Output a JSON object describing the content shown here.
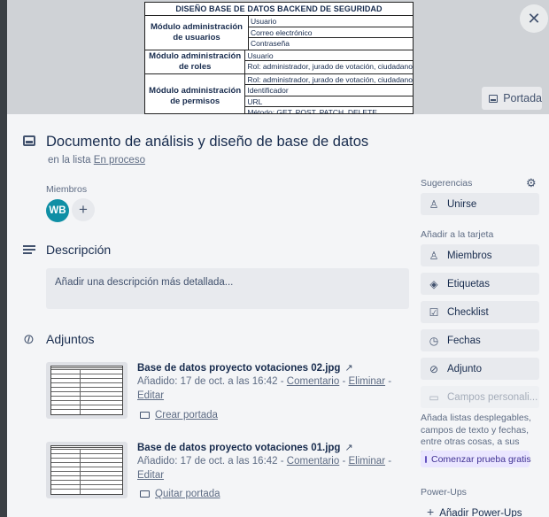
{
  "cover": {
    "table_title": "DISEÑO BASE DE DATOS BACKEND DE SEGURIDAD",
    "rows": [
      {
        "module": "Módulo administración de usuarios",
        "fields": [
          "Usuario",
          "Correo electrónico",
          "Contraseña"
        ]
      },
      {
        "module": "Módulo administración de roles",
        "fields": [
          "Usuario",
          "Rol: administrador, jurado de votación, ciudadano"
        ]
      },
      {
        "module": "Módulo administración de permisos",
        "fields": [
          "Rol: administrador, jurado de votación, ciudadano",
          "Identificador",
          "URL",
          "Método: GET, POST, PATCH, DELETE"
        ]
      }
    ],
    "cover_button": "Portada"
  },
  "card": {
    "title": "Documento de análisis y diseño de base de datos",
    "list_prefix": "en la lista",
    "list_name": "En proceso"
  },
  "members": {
    "label": "Miembros",
    "avatar_initials": "WB",
    "add": "+"
  },
  "description": {
    "title": "Descripción",
    "placeholder": "Añadir una descripción más detallada..."
  },
  "attachments": {
    "title": "Adjuntos",
    "items": [
      {
        "name": "Base de datos proyecto votaciones 02.jpg",
        "added": "Añadido: 17 de oct. a las 16:42 -",
        "comment": "Comentario",
        "sep1": "-",
        "delete": "Eliminar",
        "sep2": "-",
        "edit": "Editar",
        "cover_action": "Crear portada",
        "ext_icon": "↗"
      },
      {
        "name": "Base de datos proyecto votaciones 01.jpg",
        "added": "Añadido: 17 de oct. a las 16:42 -",
        "comment": "Comentario",
        "sep1": "-",
        "delete": "Eliminar",
        "sep2": "-",
        "edit": "Editar",
        "cover_action": "Quitar portada",
        "ext_icon": "↗"
      }
    ]
  },
  "sidebar": {
    "suggestions_label": "Sugerencias",
    "join": "Unirse",
    "add_to_card_label": "Añadir a la tarjeta",
    "buttons": [
      "Miembros",
      "Etiquetas",
      "Checklist",
      "Fechas",
      "Adjunto",
      "Campos personali..."
    ],
    "upsell_text": "Añada listas desplegables, campos de texto y fechas, entre otras cosas, a sus tarjetas.",
    "trial_button": "Comenzar prueba gratis",
    "powerups_label": "Power-Ups",
    "add_powerups": "Añadir Power-Ups"
  },
  "icons": {
    "close": "close-icon",
    "card": "card-icon",
    "description": "description-icon",
    "attachment": "paperclip-icon",
    "gear": "gear-icon"
  }
}
